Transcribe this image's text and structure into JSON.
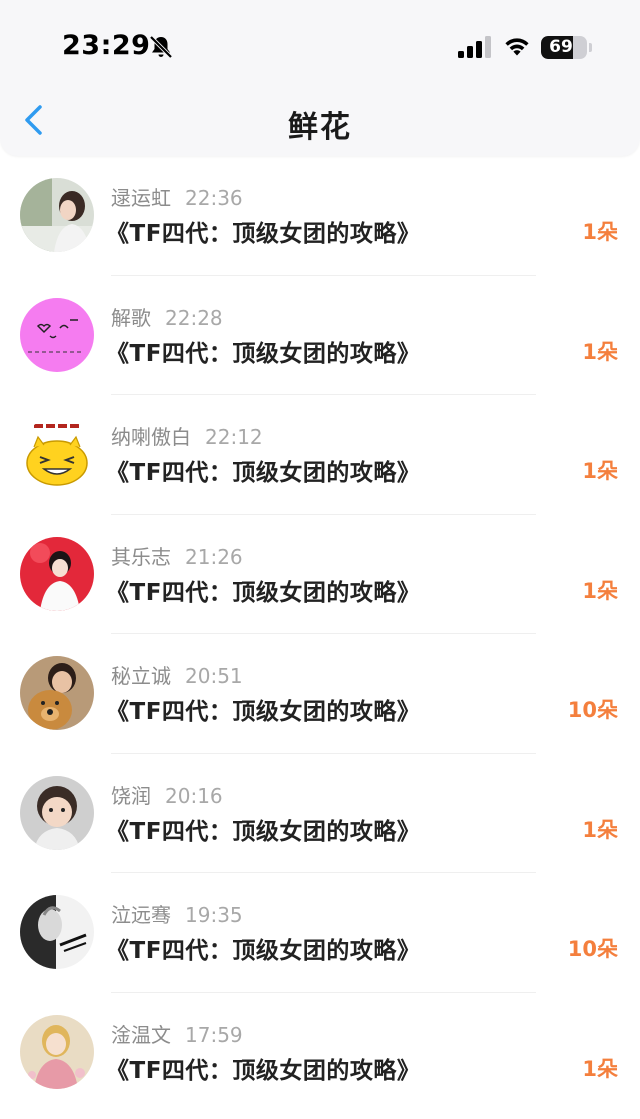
{
  "status_bar": {
    "time": "23:29",
    "battery": "69",
    "battery_percent": 69,
    "icons": [
      "bell-slash-icon",
      "signal-icon",
      "wifi-icon",
      "battery-icon"
    ]
  },
  "header": {
    "title": "鲜花",
    "back_icon": "chevron-left-icon"
  },
  "colors": {
    "accent_blue": "#2f9bf0",
    "count_orange": "#f47f3d",
    "name_gray": "#8c8c8c",
    "header_bg": "#f7f7f9"
  },
  "gifts": [
    {
      "name": "逯运虹",
      "time": "22:36",
      "work": "《TF四代：顶级女团的攻略》",
      "amount": "1朵"
    },
    {
      "name": "解歌",
      "time": "22:28",
      "work": "《TF四代：顶级女团的攻略》",
      "amount": "1朵"
    },
    {
      "name": "纳喇傲白",
      "time": "22:12",
      "work": "《TF四代：顶级女团的攻略》",
      "amount": "1朵"
    },
    {
      "name": "其乐志",
      "time": "21:26",
      "work": "《TF四代：顶级女团的攻略》",
      "amount": "1朵"
    },
    {
      "name": "秘立诚",
      "time": "20:51",
      "work": "《TF四代：顶级女团的攻略》",
      "amount": "10朵"
    },
    {
      "name": "饶润",
      "time": "20:16",
      "work": "《TF四代：顶级女团的攻略》",
      "amount": "1朵"
    },
    {
      "name": "泣远骞",
      "time": "19:35",
      "work": "《TF四代：顶级女团的攻略》",
      "amount": "10朵"
    },
    {
      "name": "淦温文",
      "time": "17:59",
      "work": "《TF四代：顶级女团的攻略》",
      "amount": "1朵"
    }
  ]
}
